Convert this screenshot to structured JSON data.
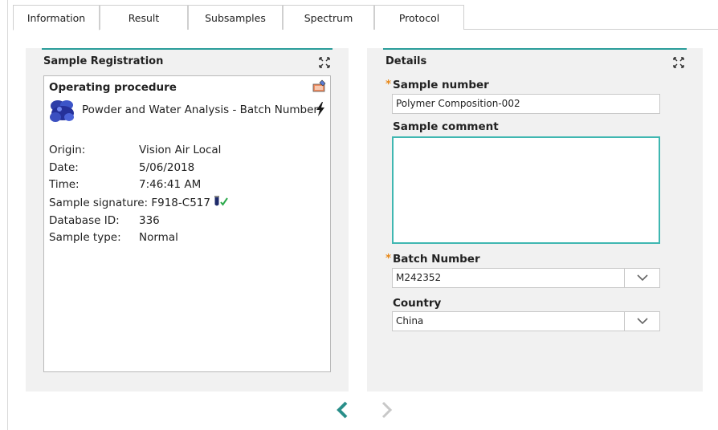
{
  "tabs": [
    {
      "label": "Information",
      "active": true
    },
    {
      "label": "Result"
    },
    {
      "label": "Subsamples"
    },
    {
      "label": "Spectrum"
    },
    {
      "label": "Protocol"
    }
  ],
  "registration": {
    "title": "Sample Registration",
    "procedure_title": "Operating procedure",
    "procedure_name": "Powder and Water Analysis - Batch Number",
    "fields": [
      {
        "label": "Origin:",
        "value": "Vision Air Local"
      },
      {
        "label": "Date:",
        "value": "5/06/2018"
      },
      {
        "label": "Time:",
        "value": "7:46:41 AM"
      },
      {
        "label": "Sample signature:",
        "value": "F918-C517"
      },
      {
        "label": "Database ID:",
        "value": "336"
      },
      {
        "label": "Sample type:",
        "value": "Normal"
      }
    ]
  },
  "details": {
    "title": "Details",
    "sample_number_label": "Sample number",
    "sample_number_value": "Polymer Composition-002",
    "sample_comment_label": "Sample comment",
    "batch_number_label": "Batch Number",
    "batch_number_value": "M242352",
    "country_label": "Country",
    "country_value": "China",
    "required_marker": "*"
  },
  "colors": {
    "accent": "#2a9d9a",
    "required": "#e8891a",
    "panel_bg": "#f1f1f1"
  }
}
